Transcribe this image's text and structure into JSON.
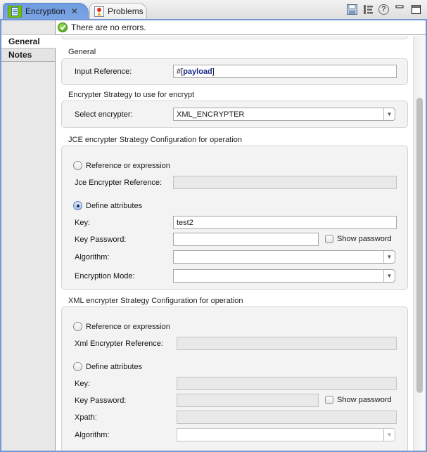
{
  "tabs": [
    {
      "label": "Encryption",
      "icon": "mule-config-icon",
      "active": true,
      "closable": true
    },
    {
      "label": "Problems",
      "icon": "problems-icon",
      "active": false
    }
  ],
  "toolbar": {
    "icons": [
      "save-icon",
      "outline-icon",
      "help-icon",
      "minimize-icon",
      "maximize-icon"
    ],
    "close_glyph": "✕",
    "help_glyph": "?"
  },
  "status": {
    "icon": "success-check-icon",
    "message": "There are no errors."
  },
  "side_tabs": [
    {
      "label": "General",
      "selected": true
    },
    {
      "label": "Notes",
      "selected": false
    }
  ],
  "sections": {
    "general": {
      "title": "General",
      "input_reference": {
        "label": "Input Reference:",
        "value_prefix": "#[",
        "value_body": "payload",
        "value_suffix": "]"
      }
    },
    "strategy": {
      "title": "Encrypter Strategy to use for encrypt",
      "select_encrypter": {
        "label": "Select encrypter:",
        "value": "XML_ENCRYPTER"
      }
    },
    "jce": {
      "title": "JCE encrypter Strategy Configuration for operation",
      "radio_reference": {
        "label": "Reference or expression",
        "checked": false
      },
      "reference_field": {
        "label": "Jce Encrypter Reference:",
        "value": ""
      },
      "radio_define": {
        "label": "Define attributes",
        "checked": true
      },
      "key": {
        "label": "Key:",
        "value": "test2"
      },
      "key_password": {
        "label": "Key Password:",
        "value": ""
      },
      "show_password": {
        "label": "Show password",
        "checked": false
      },
      "algorithm": {
        "label": "Algorithm:",
        "value": ""
      },
      "encryption_mode": {
        "label": "Encryption Mode:",
        "value": ""
      }
    },
    "xml": {
      "title": "XML encrypter Strategy Configuration for operation",
      "radio_reference": {
        "label": "Reference or expression",
        "checked": false
      },
      "reference_field": {
        "label": "Xml Encrypter Reference:",
        "value": ""
      },
      "radio_define": {
        "label": "Define attributes",
        "checked": false
      },
      "key": {
        "label": "Key:",
        "value": ""
      },
      "key_password": {
        "label": "Key Password:",
        "value": ""
      },
      "show_password": {
        "label": "Show password",
        "checked": false
      },
      "xpath": {
        "label": "Xpath:",
        "value": ""
      },
      "algorithm": {
        "label": "Algorithm:",
        "value": ""
      }
    }
  },
  "scroll": {
    "thumb_position_fraction": 0.15,
    "visible_fraction": 0.72
  }
}
